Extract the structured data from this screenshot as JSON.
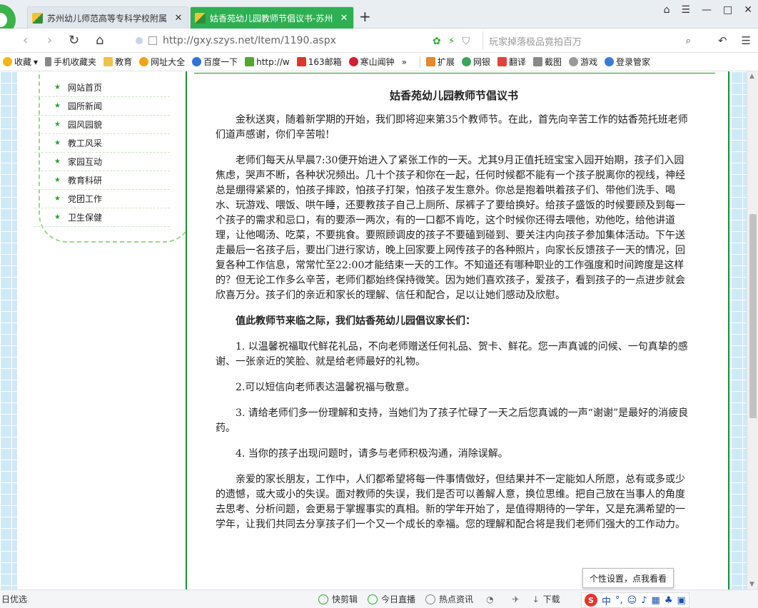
{
  "tabs": [
    {
      "title": "苏州幼儿师范高等专科学校附属",
      "active": false
    },
    {
      "title": "姑香苑幼儿园教师节倡议书-苏州",
      "active": true
    }
  ],
  "address": {
    "url": "http://gxy.szys.net/Item/1190.aspx",
    "search_placeholder": "玩家掉落极品竟拍百万"
  },
  "bookmarks": [
    {
      "label": "收藏",
      "icon": "star-icon",
      "color": "#f2b51b"
    },
    {
      "label": "手机收藏夹",
      "icon": "phone-icon",
      "color": "#888888"
    },
    {
      "label": "教育",
      "icon": "folder-icon",
      "color": "#f0c24b"
    },
    {
      "label": "网址大全",
      "icon": "globe-icon",
      "color": "#f2a21c"
    },
    {
      "label": "百度一下",
      "icon": "paw-icon",
      "color": "#3173d6"
    },
    {
      "label": "http://w",
      "icon": "link-icon",
      "color": "#55a630"
    },
    {
      "label": "163邮箱",
      "icon": "mail-icon",
      "color": "#d33b2c"
    },
    {
      "label": "寒山闻钟",
      "icon": "bell-icon",
      "color": "#c23"
    }
  ],
  "toolbar_right": [
    "扩展",
    "网银",
    "翻译",
    "截图",
    "游戏",
    "登录管家"
  ],
  "sidebar": {
    "items": [
      "网站首页",
      "园所新闻",
      "园风园貌",
      "教工风采",
      "家园互动",
      "教育科研",
      "党团工作",
      "卫生保健"
    ]
  },
  "article": {
    "title": "姑香苑幼儿园教师节倡议书",
    "paragraphs": [
      "金秋送爽，随着新学期的开始，我们即将迎来第35个教师节。在此，首先向辛苦工作的姑香苑托班老师们道声感谢，你们辛苦啦!",
      "老师们每天从早晨7:30便开始进入了紧张工作的一天。尤其9月正值托班宝宝入园开始期，孩子们入园焦虑，哭声不断，各种状况频出。几十个孩子和你在一起，任何时候都不能有一个孩子脱离你的视线，神经总是绷得紧紧的，怕孩子摔跤，怕孩子打架，怕孩子发生意外。你总是抱着哄着孩子们、带他们洗手、喝水、玩游戏、喂饭、哄午睡，还要教孩子自己上厕所、尿裤子了要给换好。给孩子盛饭的时候要顾及到每一个孩子的需求和忌口，有的要添一两次，有的一口都不肯吃，这个时候你还得去喂他，劝他吃，给他讲道理，让他喝汤、吃菜，不要挑食。要照顾调皮的孩子不要磕到碰到、要关注内向孩子参加集体活动。下午送走最后一名孩子后，要出门进行家访，晚上回家要上网传孩子的各种照片，向家长反馈孩子一天的情况，回复各种工作信息，常常忙至22:00才能结束一天的工作。不知道还有哪种职业的工作强度和时间跨度是这样的？但无论工作多么辛苦，老师们都始终保持微笑。因为她们喜欢孩子，爱孩子，看到孩子的一点进步就会欣喜万分。孩子们的亲近和家长的理解、信任和配合，足以让她们感动及欣慰。",
      "值此教师节来临之际，我们姑香苑幼儿园倡议家长们：",
      "1. 以温馨祝福取代鲜花礼品，不向老师赠送任何礼品、贺卡、鲜花。您一声真诚的问候、一句真挚的感谢、一张亲近的笑脸、就是给老师最好的礼物。",
      "2.可以短信向老师表达温馨祝福与敬意。",
      "3. 请给老师们多一份理解和支持，当她们为了孩子忙碌了一天之后您真诚的一声“谢谢”是最好的消疲良药。",
      "4. 当你的孩子出现问题时，请多与老师积极沟通，消除误解。",
      "亲爱的家长朋友，工作中，人们都希望将每一件事情做好，但结果并不一定能如人所愿，总有或多或少的遗憾，或大或小的失误。面对教师的失误，我们是否可以善解人意，换位思维。把自己放在当事人的角度去思考、分析问题，会更易于掌握事实的真相。新的学年开始了，是值得期待的一学年，又是充满希望的一学年，让我们共同去分享孩子们一个又一个成长的幸福。您的理解和配合将是我们老师们强大的工作动力。"
    ]
  },
  "statusbar": {
    "left": "日优选",
    "items": [
      "快剪辑",
      "今日直播",
      "热点资讯",
      "下载"
    ],
    "tooltip": "个性设置，点我看看",
    "ime_label": "中"
  },
  "accent_color": "#2db052"
}
